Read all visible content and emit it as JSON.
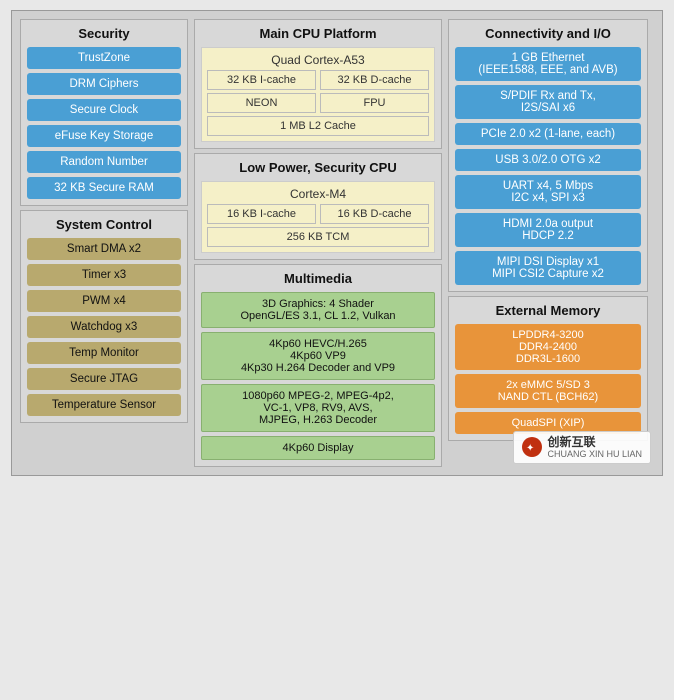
{
  "security": {
    "title": "Security",
    "buttons": [
      "TrustZone",
      "DRM Ciphers",
      "Secure Clock",
      "eFuse Key Storage",
      "Random Number",
      "32 KB Secure RAM"
    ]
  },
  "system_control": {
    "title": "System Control",
    "buttons": [
      "Smart DMA x2",
      "Timer x3",
      "PWM x4",
      "Watchdog x3",
      "Temp Monitor",
      "Secure JTAG",
      "Temperature Sensor"
    ]
  },
  "main_cpu": {
    "title": "Main CPU Platform",
    "processor": "Quad Cortex-A53",
    "icache": "32 KB I-cache",
    "dcache": "32 KB D-cache",
    "neon": "NEON",
    "fpu": "FPU",
    "l2cache": "1 MB L2 Cache"
  },
  "low_power_cpu": {
    "title": "Low Power, Security CPU",
    "processor": "Cortex-M4",
    "icache": "16 KB I-cache",
    "dcache": "16 KB D-cache",
    "tcm": "256 KB TCM"
  },
  "multimedia": {
    "title": "Multimedia",
    "items": [
      "3D Graphics: 4 Shader\nOpenGL/ES 3.1, CL 1.2, Vulkan",
      "4Kp60 HEVC/H.265\n4Kp60 VP9\n4Kp30 H.264 Decoder and VP9",
      "1080p60 MPEG-2, MPEG-4p2,\nVC-1, VP8, RV9, AVS,\nMJPEG, H.263 Decoder",
      "4Kp60 Display"
    ]
  },
  "connectivity": {
    "title": "Connectivity and I/O",
    "buttons": [
      "1 GB Ethernet\n(IEEE1588, EEE, and AVB)",
      "S/PDIF Rx and Tx,\nI2S/SAI x6",
      "PCIe 2.0 x2 (1-lane, each)",
      "USB 3.0/2.0 OTG x2",
      "UART x4, 5 Mbps\nI2C x4, SPI x3",
      "HDMI 2.0a output\nHDCP 2.2",
      "MIPI DSI Display x1\nMIPI CSI2 Capture x2"
    ]
  },
  "external_memory": {
    "title": "External Memory",
    "buttons": [
      "LPDDR4-3200\nDDR4-2400\nDDR3L-1600",
      "2x eMMC 5/SD 3\nNAND CTL (BCH62)",
      "QuadSPI (XIP)"
    ]
  },
  "watermark": {
    "text": "创新互联",
    "subtext": "CHUANG XIN HU LIAN"
  }
}
